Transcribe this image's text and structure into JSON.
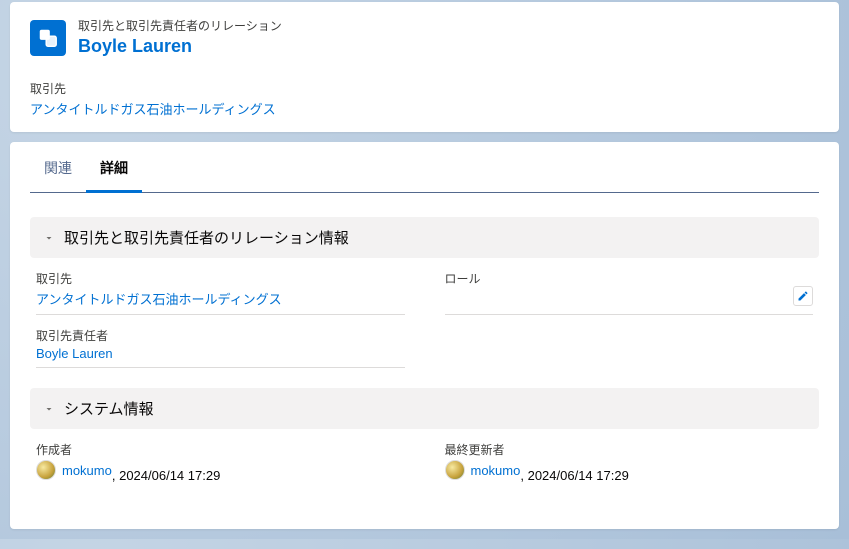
{
  "header": {
    "record_type": "取引先と取引先責任者のリレーション",
    "record_title": "Boyle Lauren",
    "account_label": "取引先",
    "account_value": "アンタイトルドガス石油ホールディングス"
  },
  "tabs": {
    "related": "関連",
    "detail": "詳細"
  },
  "sections": {
    "relation_info": {
      "title": "取引先と取引先責任者のリレーション情報",
      "fields": {
        "account_label": "取引先",
        "account_value": "アンタイトルドガス石油ホールディングス",
        "role_label": "ロール",
        "role_value": "",
        "contact_label": "取引先責任者",
        "contact_value": "Boyle Lauren"
      }
    },
    "system_info": {
      "title": "システム情報",
      "fields": {
        "created_by_label": "作成者",
        "created_by_user": "mokumo",
        "created_by_time": "2024/06/14 17:29",
        "modified_by_label": "最終更新者",
        "modified_by_user": "mokumo",
        "modified_by_time": "2024/06/14 17:29"
      }
    }
  }
}
